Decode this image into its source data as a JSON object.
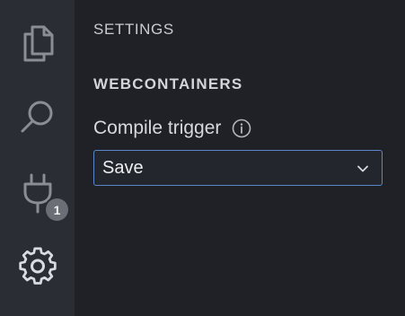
{
  "activity_bar": {
    "items": [
      {
        "name": "explorer",
        "icon": "files-icon"
      },
      {
        "name": "search",
        "icon": "search-icon"
      },
      {
        "name": "extensions",
        "icon": "plug-icon",
        "badge": "1"
      },
      {
        "name": "settings",
        "icon": "gear-icon"
      }
    ]
  },
  "panel": {
    "title": "SETTINGS",
    "section": "WEBCONTAINERS",
    "setting": {
      "label": "Compile trigger",
      "info_icon": "info-icon",
      "value": "Save",
      "dropdown_icon": "chevron-down-icon"
    }
  },
  "colors": {
    "activity_bar_bg": "#2a2d33",
    "panel_bg": "#1f2126",
    "focus_border": "#5b86c7",
    "badge_bg": "#6b6e74"
  }
}
